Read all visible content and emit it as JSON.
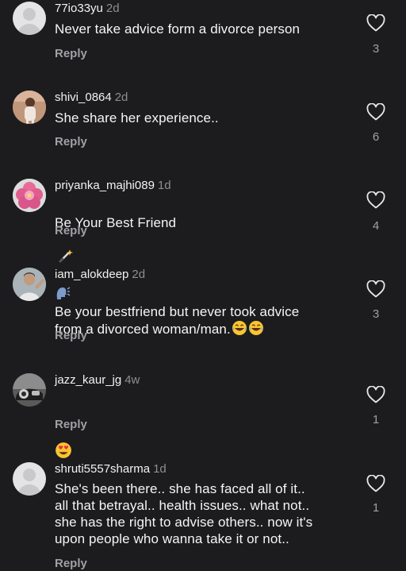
{
  "comments": [
    {
      "username": "77io33yu",
      "time": "2d",
      "text": "Never take advice form a divorce person",
      "reply_label": "Reply",
      "likes": "3",
      "avatar": "default-avatar"
    },
    {
      "username": "shivi_0864",
      "time": "2d",
      "text": "She share her experience..",
      "reply_label": "Reply",
      "likes": "6",
      "avatar": "photo-avatar"
    },
    {
      "username": "priyanka_majhi089",
      "time": "1d",
      "text": "Be Your Best Friend",
      "reply_label": "Reply",
      "likes": "4",
      "avatar": "flower-avatar"
    },
    {
      "username": "iam_alokdeep",
      "time": "2d",
      "text": "Be your bestfriend but never took advice\nfrom a divorced woman/man.",
      "reply_label": "Reply",
      "likes": "3",
      "avatar": "photo-avatar"
    },
    {
      "username": "jazz_kaur_jg",
      "time": "4w",
      "text": "",
      "reply_label": "Reply",
      "likes": "1",
      "avatar": "car-avatar"
    },
    {
      "username": "shruti5557sharma",
      "time": "1d",
      "text": "She's been there.. she has faced all of it..\nall that betrayal.. health issues.. what not..\nshe has the right to advise others.. now it's\nupon people who wanna take it or not..",
      "reply_label": "Reply",
      "likes": "1",
      "avatar": "default-avatar"
    }
  ],
  "colors": {
    "background": "#1c1c1e",
    "text": "#f5f5f5",
    "muted": "#8e8e93",
    "reply": "#a0a0a5"
  }
}
